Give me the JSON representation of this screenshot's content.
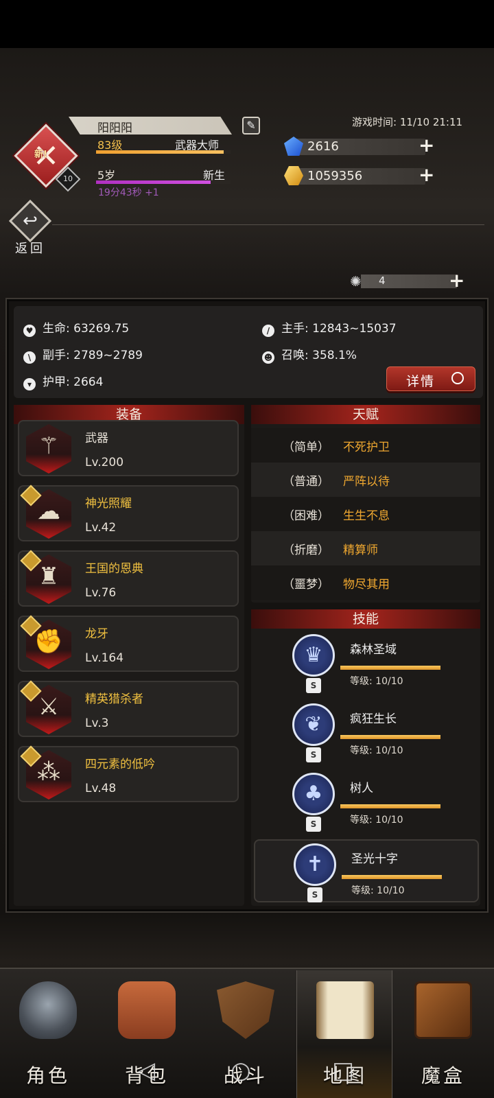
{
  "player": {
    "name": "阳阳阳",
    "level_text": "83级",
    "title": "武器大师",
    "level_progress": 0.95,
    "age_text": "5岁",
    "stage": "新生",
    "age_progress": 0.85,
    "timer": "19分43秒 +1",
    "emblem_new": "新!",
    "emblem_level": "10"
  },
  "game_time": "游戏时间: 11/10 21:11",
  "resources": {
    "gems": "2616",
    "gold": "1059356",
    "stamina": "4"
  },
  "back_label": "返回",
  "stats": {
    "hp": "生命: 63269.75",
    "main_hand": "主手: 12843~15037",
    "off_hand": "副手: 2789~2789",
    "summon": "召唤: 358.1%",
    "armor": "护甲: 2664",
    "detail_label": "详情"
  },
  "equipment": {
    "title": "装备",
    "items": [
      {
        "name": "武器",
        "level": "Lv.200",
        "icon": "staff-icon",
        "starred": false
      },
      {
        "name": "神光照耀",
        "level": "Lv.42",
        "icon": "hat-icon",
        "starred": true
      },
      {
        "name": "王国的恩典",
        "level": "Lv.76",
        "icon": "armor-icon",
        "starred": true
      },
      {
        "name": "龙牙",
        "level": "Lv.164",
        "icon": "gauntlet-icon",
        "starred": true
      },
      {
        "name": "精英猎杀者",
        "level": "Lv.3",
        "icon": "boots-icon",
        "starred": true
      },
      {
        "name": "四元素的低吟",
        "level": "Lv.48",
        "icon": "trinket-icon",
        "starred": true
      }
    ]
  },
  "talents": {
    "title": "天赋",
    "rows": [
      {
        "difficulty": "（简单）",
        "name": "不死护卫"
      },
      {
        "difficulty": "（普通）",
        "name": "严阵以待"
      },
      {
        "difficulty": "（困难）",
        "name": "生生不息"
      },
      {
        "difficulty": "（折磨）",
        "name": "精算师"
      },
      {
        "difficulty": "（噩梦）",
        "name": "物尽其用"
      }
    ]
  },
  "skills": {
    "title": "技能",
    "items": [
      {
        "name": "森林圣域",
        "level": "等级: 10/10",
        "badge": "S",
        "progress": 1.0,
        "icon": "crown-icon"
      },
      {
        "name": "疯狂生长",
        "level": "等级: 10/10",
        "badge": "S",
        "progress": 1.0,
        "icon": "leaves-icon"
      },
      {
        "name": "树人",
        "level": "等级: 10/10",
        "badge": "S",
        "progress": 1.0,
        "icon": "tree-icon"
      },
      {
        "name": "圣光十字",
        "level": "等级: 10/10",
        "badge": "S",
        "progress": 1.0,
        "icon": "cross-icon"
      }
    ]
  },
  "nav": {
    "items": [
      {
        "label": "角色",
        "icon": "helmet-icon"
      },
      {
        "label": "背包",
        "icon": "backpack-icon"
      },
      {
        "label": "战斗",
        "icon": "shield-sword-icon"
      },
      {
        "label": "地图",
        "icon": "scroll-icon",
        "active": true
      },
      {
        "label": "魔盒",
        "icon": "magic-box-icon"
      }
    ]
  },
  "colors": {
    "accent_red": "#a3241c",
    "gold_text": "#f0c040",
    "talent_text": "#f0a830",
    "purple_timer": "#a05ab8"
  }
}
